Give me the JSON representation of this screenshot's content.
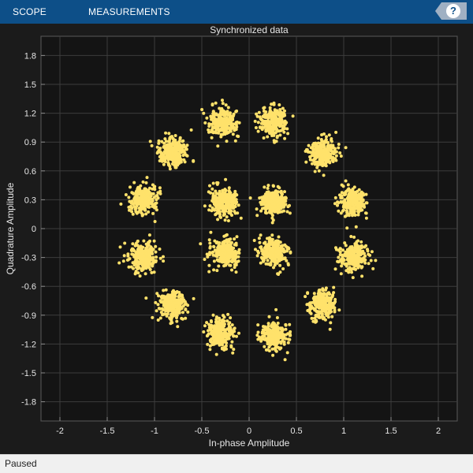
{
  "toolstrip": {
    "tabs": [
      {
        "label": "SCOPE"
      },
      {
        "label": "MEASUREMENTS"
      }
    ],
    "help_label": "?"
  },
  "colors": {
    "toolstrip_bg": "#0d4f88",
    "plot_bg": "#141414",
    "figure_bg": "#1b1b1b",
    "grid": "#3c3c3c",
    "marker": "#ffe26b",
    "text": "#e6e6e6"
  },
  "status": {
    "text": "Paused"
  },
  "chart_data": {
    "type": "scatter",
    "title": "Synchronized data",
    "xlabel": "In-phase Amplitude",
    "ylabel": "Quadrature Amplitude",
    "xlim": [
      -2.2,
      2.2
    ],
    "ylim": [
      -2.0,
      2.0
    ],
    "xticks": [
      -2,
      -1.5,
      -1,
      -0.5,
      0,
      0.5,
      1,
      1.5,
      2
    ],
    "yticks": [
      -1.8,
      -1.5,
      -1.2,
      -0.9,
      -0.6,
      -0.3,
      0,
      0.3,
      0.6,
      0.9,
      1.2,
      1.5,
      1.8
    ],
    "grid": true,
    "cluster_spread": 0.085,
    "points_per_cluster": 260,
    "clusters": [
      {
        "x": 0.26,
        "y": 1.12
      },
      {
        "x": 0.78,
        "y": 0.78
      },
      {
        "x": 1.1,
        "y": 0.29
      },
      {
        "x": 1.1,
        "y": -0.3
      },
      {
        "x": 0.77,
        "y": -0.8
      },
      {
        "x": 0.27,
        "y": -1.11
      },
      {
        "x": -0.3,
        "y": -1.09
      },
      {
        "x": -0.81,
        "y": -0.79
      },
      {
        "x": -1.12,
        "y": -0.29
      },
      {
        "x": -1.11,
        "y": 0.3
      },
      {
        "x": -0.81,
        "y": 0.8
      },
      {
        "x": -0.28,
        "y": 1.11
      },
      {
        "x": 0.26,
        "y": 0.27
      },
      {
        "x": 0.26,
        "y": -0.25
      },
      {
        "x": -0.26,
        "y": -0.25
      },
      {
        "x": -0.26,
        "y": 0.28
      }
    ]
  }
}
